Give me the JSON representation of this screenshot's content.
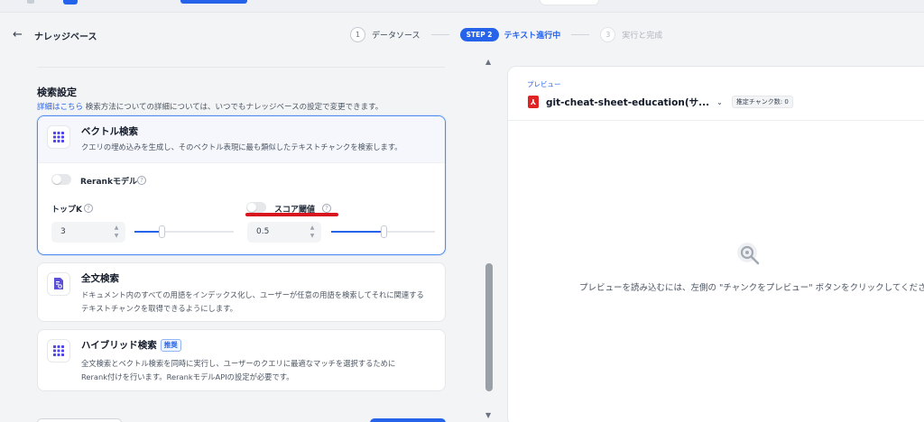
{
  "header": {
    "back_title": "ナレッジベース",
    "steps": [
      {
        "num": "1",
        "label": "データソース"
      },
      {
        "pill": "STEP 2",
        "label": "テキスト進行中"
      },
      {
        "num": "3",
        "label": "実行と完成"
      }
    ]
  },
  "search_settings": {
    "title": "検索設定",
    "desc_link": "詳細はこちら",
    "desc": " 検索方法についての詳細については、いつでもナレッジベースの設定で変更できます。",
    "vector": {
      "title": "ベクトル検索",
      "desc": "クエリの埋め込みを生成し、そのベクトル表現に最も類似したテキストチャンクを検索します。",
      "rerank_label": "Rerankモデル",
      "rerank_enabled": false,
      "topk_label": "トップK",
      "topk_value": "3",
      "topk_slider": 0.27,
      "score_label": "スコア閾値",
      "score_enabled": false,
      "score_value": "0.5",
      "score_slider": 0.5
    },
    "fulltext": {
      "title": "全文検索",
      "desc_line1": "ドキュメント内のすべての用語をインデックス化し、ユーザーが任意の用語を検索してそれに関連する",
      "desc_line2": "テキストチャンクを取得できるようにします。"
    },
    "hybrid": {
      "title": "ハイブリッド検索",
      "badge": "推奨",
      "desc_line1": "全文検索とベクトル検索を同時に実行し、ユーザーのクエリに最適なマッチを選択するために",
      "desc_line2": "Rerank付けを行います。RerankモデルAPIの設定が必要です。"
    }
  },
  "preview": {
    "label": "プレビュー",
    "file_name": "git-cheat-sheet-education(サ...",
    "chunk_count": "推定チャンク数: 0",
    "empty_text": "プレビューを読み込むには、左側の \"チャンクをプレビュー\" ボタンをクリックしてください"
  },
  "colors": {
    "accent": "#2563eb",
    "annotation_red": "#d8141e",
    "pdf_red": "#e02424"
  }
}
